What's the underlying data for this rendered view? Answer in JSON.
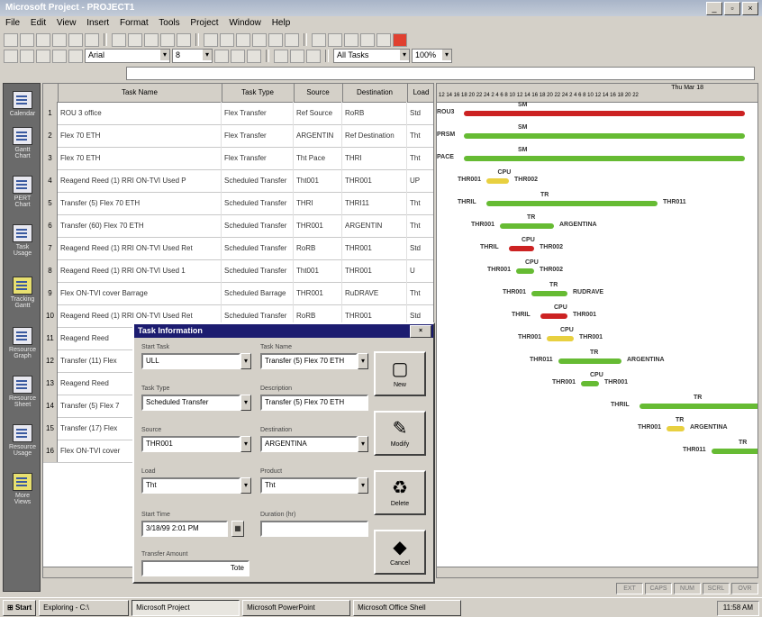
{
  "window": {
    "title": "Microsoft Project - PROJECT1",
    "min_label": "_",
    "max_label": "▫",
    "close_label": "×"
  },
  "menu": [
    "File",
    "Edit",
    "View",
    "Insert",
    "Format",
    "Tools",
    "Project",
    "Window",
    "Help"
  ],
  "toolbar": {
    "font": "Arial",
    "font_size": "8",
    "filter": "All Tasks",
    "zoom": "100%"
  },
  "viewbar": [
    "Calendar",
    "Gantt Chart",
    "PERT Chart",
    "Task Usage",
    "Tracking Gantt",
    "Resource Graph",
    "Resource Sheet",
    "Resource Usage",
    "More Views"
  ],
  "table": {
    "columns": [
      "",
      "Task Name",
      "Task Type",
      "Source",
      "Destination",
      "Load"
    ],
    "rows": [
      {
        "n": "1",
        "name": "ROU 3 office",
        "type": "Flex Transfer",
        "source": "Ref Source",
        "dest": "RoRB",
        "load": "Std"
      },
      {
        "n": "2",
        "name": "Flex 70 ETH",
        "type": "Flex Transfer",
        "source": "ARGENTIN",
        "dest": "Ref Destination",
        "load": "Tht"
      },
      {
        "n": "3",
        "name": "Flex 70 ETH",
        "type": "Flex Transfer",
        "source": "Tht Pace",
        "dest": "THRI",
        "load": "Tht"
      },
      {
        "n": "4",
        "name": "Reagend Reed (1) RRI ON-TVI Used P",
        "type": "Scheduled Transfer",
        "source": "Tht001",
        "dest": "THR001",
        "load": "UP"
      },
      {
        "n": "5",
        "name": "Transfer (5) Flex 70 ETH",
        "type": "Scheduled Transfer",
        "source": "THRI",
        "dest": "THRI11",
        "load": "Tht"
      },
      {
        "n": "6",
        "name": "Transfer (60) Flex 70 ETH",
        "type": "Scheduled Transfer",
        "source": "THR001",
        "dest": "ARGENTIN",
        "load": "Tht"
      },
      {
        "n": "7",
        "name": "Reagend Reed (1) RRI ON-TVI Used Ret",
        "type": "Scheduled Transfer",
        "source": "RoRB",
        "dest": "THR001",
        "load": "Std"
      },
      {
        "n": "8",
        "name": "Reagend Reed (1) RRI ON-TVI Used 1",
        "type": "Scheduled Transfer",
        "source": "Tht001",
        "dest": "THR001",
        "load": "U"
      },
      {
        "n": "9",
        "name": "Flex ON-TVI cover Barrage",
        "type": "Scheduled Barrage",
        "source": "THR001",
        "dest": "RuDRAVE",
        "load": "Tht"
      },
      {
        "n": "10",
        "name": "Reagend Reed (1) RRI ON-TVI Used Ret",
        "type": "Scheduled Transfer",
        "source": "RoRB",
        "dest": "THR001",
        "load": "Std"
      },
      {
        "n": "11",
        "name": "Reagend Reed",
        "type": "",
        "source": "",
        "dest": "",
        "load": ""
      },
      {
        "n": "12",
        "name": "Transfer (11) Flex",
        "type": "",
        "source": "",
        "dest": "",
        "load": ""
      },
      {
        "n": "13",
        "name": "Reagend Reed",
        "type": "",
        "source": "",
        "dest": "",
        "load": ""
      },
      {
        "n": "14",
        "name": "Transfer (5) Flex 7",
        "type": "",
        "source": "",
        "dest": "",
        "load": ""
      },
      {
        "n": "15",
        "name": "Transfer (17) Flex",
        "type": "",
        "source": "",
        "dest": "",
        "load": ""
      },
      {
        "n": "16",
        "name": "Flex ON-TVI cover",
        "type": "",
        "source": "",
        "dest": "",
        "load": ""
      }
    ]
  },
  "gantt": {
    "header_title": "Thu Mar 18",
    "tick_labels": "12 14 16 18 20 22 24 2 4 6 8 10 12 14 16 18 20 22 24 2 4 6 8 10 12 14 16 18 20 22",
    "bars": [
      {
        "label_top": "SM",
        "left_text": "ROU3",
        "right_text": "",
        "color": "#cc2222"
      },
      {
        "label_top": "SM",
        "left_text": "PRSM",
        "right_text": "",
        "color": "#66bb33"
      },
      {
        "label_top": "SM",
        "left_text": "PACE",
        "right_text": "",
        "color": "#66bb33"
      },
      {
        "label_top": "CPU",
        "left_text": "THR001",
        "right_text": "THR002",
        "color": "#e8d040"
      },
      {
        "label_top": "TR",
        "left_text": "THRIL",
        "right_text": "THR011",
        "color": "#66bb33"
      },
      {
        "label_top": "TR",
        "left_text": "THR001",
        "right_text": "ARGENTINA",
        "color": "#66bb33"
      },
      {
        "label_top": "CPU",
        "left_text": "THRIL",
        "right_text": "THR002",
        "color": "#cc2222"
      },
      {
        "label_top": "CPU",
        "left_text": "THR001",
        "right_text": "THR002",
        "color": "#66bb33"
      },
      {
        "label_top": "TR",
        "left_text": "THR001",
        "right_text": "RUDRAVE",
        "color": "#66bb33"
      },
      {
        "label_top": "CPU",
        "left_text": "THRIL",
        "right_text": "THR001",
        "color": "#cc2222"
      },
      {
        "label_top": "CPU",
        "left_text": "THR001",
        "right_text": "THR001",
        "color": "#e8d040"
      },
      {
        "label_top": "TR",
        "left_text": "THR011",
        "right_text": "ARGENTINA",
        "color": "#66bb33"
      },
      {
        "label_top": "CPU",
        "left_text": "THR001",
        "right_text": "THR001",
        "color": "#66bb33"
      },
      {
        "label_top": "TR",
        "left_text": "THRIL",
        "right_text": "",
        "color": "#66bb33"
      },
      {
        "label_top": "TR",
        "left_text": "THR001",
        "right_text": "ARGENTINA",
        "color": "#e8d040"
      },
      {
        "label_top": "TR",
        "left_text": "THR011",
        "right_text": "",
        "color": "#66bb33"
      }
    ]
  },
  "dialog": {
    "title": "Task Information",
    "close_label": "×",
    "fields": {
      "start_task_label": "Start Task",
      "start_task_value": "ULL",
      "type_label": "Task Type",
      "type_value": "Scheduled Transfer",
      "source_label": "Source",
      "source_value": "THR001",
      "load_label": "Load",
      "load_value": "Tht",
      "start_time_label": "Start Time",
      "start_time_value": "3/18/99 2:01 PM",
      "transfer_amount_label": "Transfer Amount",
      "transfer_amount_value": "Tote",
      "task_name_label": "Task Name",
      "task_name_value": "Transfer (5) Flex 70 ETH",
      "description_label": "Description",
      "description_value": "Transfer (5) Flex 70 ETH",
      "destination_label": "Destination",
      "destination_value": "ARGENTINA",
      "product_label": "Product",
      "product_value": "Tht",
      "duration_label": "Duration (hr)",
      "duration_value": ""
    },
    "buttons": {
      "new": "New",
      "modify": "Modify",
      "delete": "Delete",
      "cancel": "Cancel"
    }
  },
  "taskbar": {
    "start": "Start",
    "items": [
      "Exploring - C:\\",
      "Microsoft Project",
      "Microsoft PowerPoint",
      "Microsoft Office Shell"
    ],
    "clock": "11:58 AM"
  },
  "status": {
    "panes": [
      "EXT",
      "CAPS",
      "NUM",
      "SCRL",
      "OVR"
    ]
  }
}
